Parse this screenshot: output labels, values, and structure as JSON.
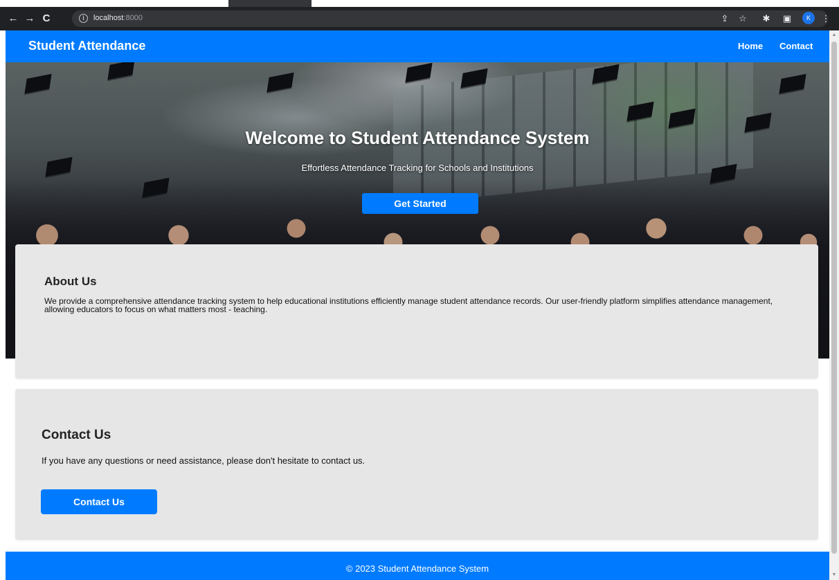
{
  "browser": {
    "url_host": "localhost",
    "url_port": ":8000",
    "profile_initial": "K"
  },
  "navbar": {
    "brand": "Student Attendance",
    "links": [
      "Home",
      "Contact"
    ]
  },
  "hero": {
    "title": "Welcome to Student Attendance System",
    "subtitle": "Effortless Attendance Tracking for Schools and Institutions",
    "cta_label": "Get Started"
  },
  "about": {
    "title": "About Us",
    "text": "We provide a comprehensive attendance tracking system to help educational institutions efficiently manage student attendance records. Our user-friendly platform simplifies attendance management, allowing educators to focus on what matters most - teaching."
  },
  "contact": {
    "title": "Contact Us",
    "text": "If you have any questions or need assistance, please don't hesitate to contact us.",
    "button_label": "Contact Us"
  },
  "footer": {
    "text": "© 2023 Student Attendance System"
  },
  "colors": {
    "primary": "#007bff",
    "card_bg": "#e6e6e6",
    "browser_bar": "#202124"
  }
}
